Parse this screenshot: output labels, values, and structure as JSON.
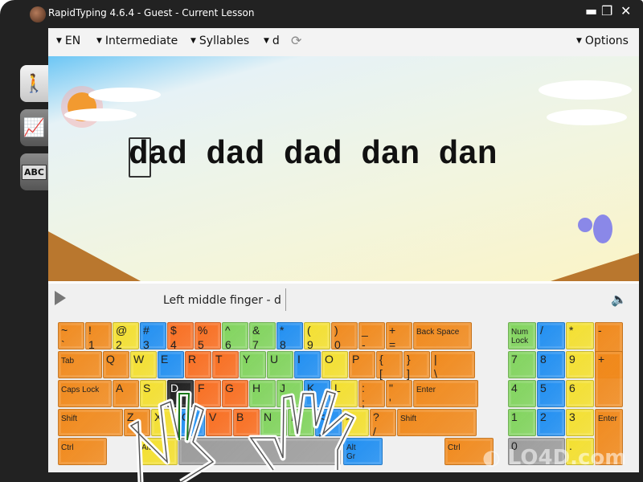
{
  "window": {
    "title": "RapidTyping 4.6.4 - Guest - Current Lesson",
    "controls": [
      "minimize",
      "restore",
      "close"
    ]
  },
  "toolbar": {
    "language": "EN",
    "level": "Intermediate",
    "lesson_type": "Syllables",
    "letter": "d",
    "options": "Options"
  },
  "sidebar": {
    "items": [
      {
        "name": "lesson",
        "icon": "walking-person-icon"
      },
      {
        "name": "statistics",
        "icon": "chart-icon"
      },
      {
        "name": "lessons-editor",
        "icon": "abc-documents-icon"
      }
    ]
  },
  "lesson": {
    "current_char": "d",
    "text": "dad dad dad dan dan"
  },
  "status": {
    "hint": "Left middle finger - d"
  },
  "colors": {
    "o": "#f0891c",
    "y": "#f3df2e",
    "b": "#1f8ef1",
    "r": "#f86d1f",
    "g": "#80d35c",
    "k": "#1a1a1a",
    "s": "#9c9c9c"
  },
  "keyboard": {
    "rows": [
      [
        [
          "~",
          "`",
          "o"
        ],
        [
          "!",
          "1",
          "o"
        ],
        [
          "@",
          "2",
          "y"
        ],
        [
          "#",
          "3",
          "b"
        ],
        [
          "$",
          "4",
          "r"
        ],
        [
          "%",
          "5",
          "r"
        ],
        [
          "^",
          "6",
          "g"
        ],
        [
          "&",
          "7",
          "g"
        ],
        [
          "*",
          "8",
          "b"
        ],
        [
          "(",
          "9",
          "y"
        ],
        [
          ")",
          "0",
          "o"
        ],
        [
          "_",
          "-",
          "o"
        ],
        [
          "+",
          "=",
          "o"
        ],
        [
          "Back Space",
          "",
          "o"
        ]
      ],
      [
        [
          "Tab",
          "",
          "o"
        ],
        [
          "Q",
          "",
          "o"
        ],
        [
          "W",
          "",
          "y"
        ],
        [
          "E",
          "",
          "b"
        ],
        [
          "R",
          "",
          "r"
        ],
        [
          "T",
          "",
          "r"
        ],
        [
          "Y",
          "",
          "g"
        ],
        [
          "U",
          "",
          "g"
        ],
        [
          "I",
          "",
          "b"
        ],
        [
          "O",
          "",
          "y"
        ],
        [
          "P",
          "",
          "o"
        ],
        [
          "{",
          "[",
          "o"
        ],
        [
          "}",
          "]",
          "o"
        ],
        [
          "|",
          "\\",
          "o"
        ]
      ],
      [
        [
          "Caps Lock",
          "",
          "o"
        ],
        [
          "A",
          "",
          "o"
        ],
        [
          "S",
          "",
          "y"
        ],
        [
          "D",
          "",
          "k"
        ],
        [
          "F",
          "",
          "r"
        ],
        [
          "G",
          "",
          "r"
        ],
        [
          "H",
          "",
          "g"
        ],
        [
          "J",
          "",
          "g"
        ],
        [
          "K",
          "",
          "b"
        ],
        [
          "L",
          "",
          "y"
        ],
        [
          ":",
          ";",
          "o"
        ],
        [
          "\"",
          "'",
          "o"
        ],
        [
          "Enter",
          "",
          "o"
        ]
      ],
      [
        [
          "Shift",
          "",
          "o"
        ],
        [
          "Z",
          "",
          "o"
        ],
        [
          "X",
          "",
          "y"
        ],
        [
          "C",
          "",
          "b"
        ],
        [
          "V",
          "",
          "r"
        ],
        [
          "B",
          "",
          "r"
        ],
        [
          "N",
          "",
          "g"
        ],
        [
          "M",
          "",
          "g"
        ],
        [
          "<",
          ",",
          "b"
        ],
        [
          ">",
          ".",
          "y"
        ],
        [
          "?",
          "/",
          "o"
        ],
        [
          "Shift",
          "",
          "o"
        ]
      ],
      [
        [
          "Ctrl",
          "",
          "o"
        ],
        [
          "Alt",
          "",
          "y"
        ],
        [
          "",
          "",
          "s"
        ],
        [
          "Alt",
          "Gr",
          "b"
        ],
        [
          "Ctrl",
          "",
          "o"
        ]
      ]
    ],
    "numpad": [
      [
        "Num",
        "Lock",
        "g"
      ],
      [
        "/",
        "",
        "b"
      ],
      [
        "*",
        "",
        "y"
      ],
      [
        "-",
        "",
        "o"
      ],
      [
        "7",
        "",
        "g"
      ],
      [
        "8",
        "",
        "b"
      ],
      [
        "9",
        "",
        "y"
      ],
      [
        "+",
        "",
        "o"
      ],
      [
        "4",
        "",
        "g"
      ],
      [
        "5",
        "",
        "b"
      ],
      [
        "6",
        "",
        "y"
      ],
      [
        "1",
        "",
        "g"
      ],
      [
        "2",
        "",
        "b"
      ],
      [
        "3",
        "",
        "y"
      ],
      [
        "Enter",
        "",
        "o"
      ],
      [
        "0",
        "",
        "s"
      ],
      [
        ".",
        "",
        "y"
      ]
    ]
  }
}
